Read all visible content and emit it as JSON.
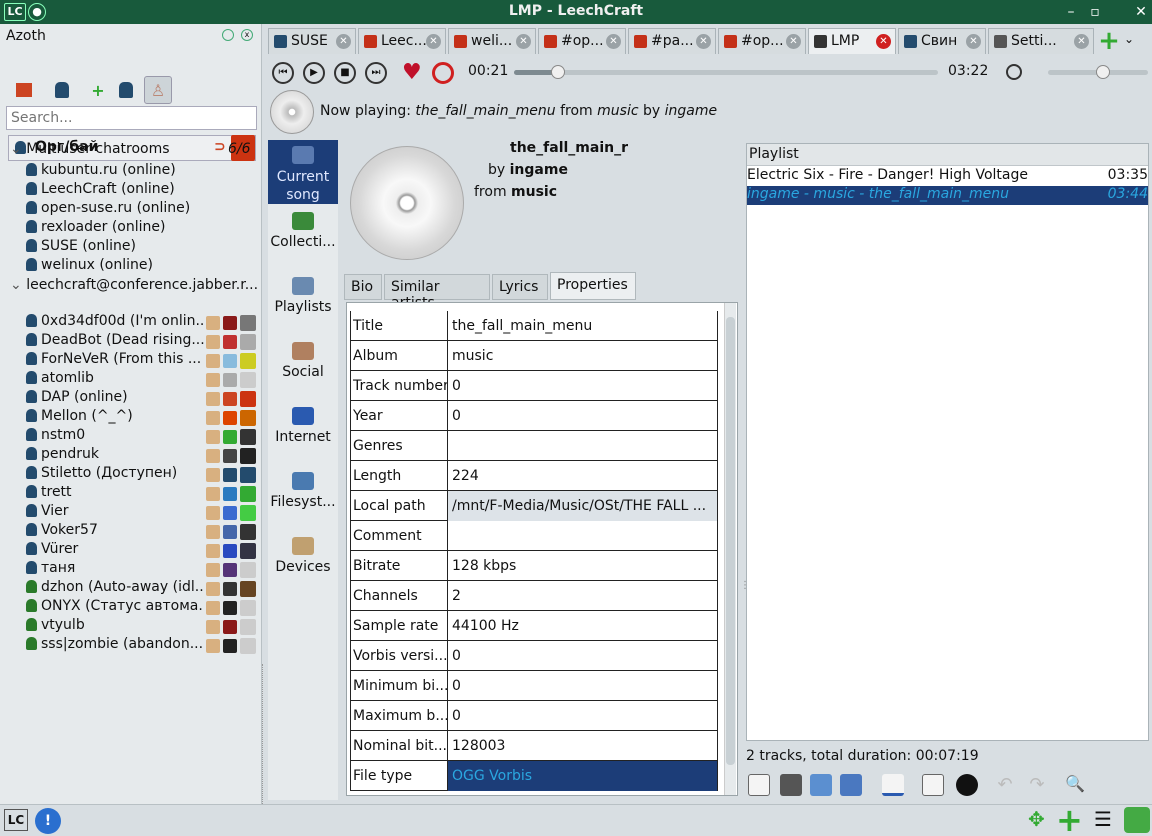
{
  "window": {
    "title": "LMP - LeechCraft",
    "app_icon": "LC"
  },
  "left": {
    "title": "Azoth",
    "search_placeholder": "Search...",
    "account": "Орг/бай",
    "mucs_group": "Multiuser chatrooms",
    "mucs_count": "6/6",
    "rooms": [
      "kubuntu.ru (online)",
      "LeechCraft (online)",
      "open-suse.ru (online)",
      "rexloader (online)",
      "SUSE (online)",
      "welinux (online)"
    ],
    "conference": "leechcraft@conference.jabber.r...",
    "contacts": [
      "0xd34df00d (I'm onlin...",
      "DeadBot (Dead rising...)",
      "ForNeVeR (From this ...",
      "atomlib",
      "DAP (online)",
      "Mellon (^_^)",
      "nstm0",
      "pendruk",
      "Stiletto (Доступен)",
      "trett",
      "Vier",
      "Voker57",
      "Vürer",
      "таня",
      "dzhon (Auto-away (idl...",
      "ONYX (Статус автома...",
      "vtyulb",
      "sss|zombie (abandon..."
    ]
  },
  "tabs": [
    "SUSE",
    "Leec...",
    "weli...",
    "#op...",
    "#pa...",
    "#op...",
    "LMP",
    "Свин",
    "Setti..."
  ],
  "player": {
    "elapsed": "00:21",
    "total": "03:22",
    "progress": 0.104,
    "volume": 0.55
  },
  "now_playing": {
    "prefix": "Now playing:",
    "title": "the_fall_main_menu",
    "from": "from",
    "album": "music",
    "by": "by",
    "artist": "ingame"
  },
  "side": [
    "Current song",
    "Collecti...",
    "Playlists",
    "Social",
    "Internet",
    "Filesyst...",
    "Devices"
  ],
  "song": {
    "title": "the_fall_main_r",
    "by": "by",
    "artist": "ingame",
    "from": "from",
    "album": "music"
  },
  "prop_tabs": [
    "Bio",
    "Similar artists",
    "Lyrics",
    "Properties"
  ],
  "properties": [
    [
      "Title",
      "the_fall_main_menu"
    ],
    [
      "Album",
      "music"
    ],
    [
      "Track number",
      "0"
    ],
    [
      "Year",
      "0"
    ],
    [
      "Genres",
      ""
    ],
    [
      "Length",
      "224"
    ],
    [
      "Local path",
      "/mnt/F-Media/Music/OSt/THE FALL ..."
    ],
    [
      "Comment",
      ""
    ],
    [
      "Bitrate",
      "128 kbps"
    ],
    [
      "Channels",
      "2"
    ],
    [
      "Sample rate",
      "44100 Hz"
    ],
    [
      "Vorbis versi...",
      "0"
    ],
    [
      "Minimum bi...",
      "0"
    ],
    [
      "Maximum b...",
      "0"
    ],
    [
      "Nominal bit...",
      "128003"
    ],
    [
      "File type",
      "OGG Vorbis"
    ]
  ],
  "playlist": {
    "header": "Playlist",
    "items": [
      {
        "name": "Electric Six - Fire - Danger! High Voltage",
        "dur": "03:35"
      },
      {
        "name": "ingame - music - the_fall_main_menu",
        "dur": "03:44"
      }
    ],
    "status": "2 tracks, total duration: 00:07:19"
  },
  "colors": {
    "titlebar": "#185a3c",
    "selection": "#1c3d78",
    "accent": "#2aa7e0"
  }
}
